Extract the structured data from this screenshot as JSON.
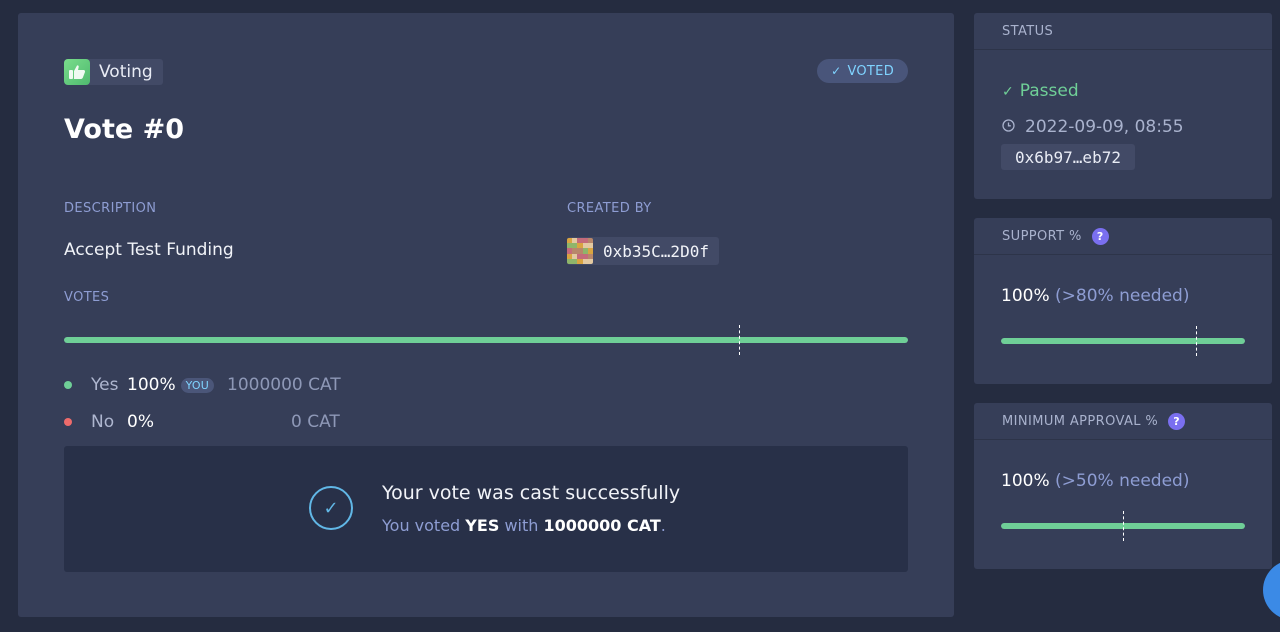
{
  "app": {
    "label": "Voting",
    "voted_badge": "VOTED"
  },
  "vote": {
    "title": "Vote #0",
    "description_label": "DESCRIPTION",
    "description": "Accept Test Funding",
    "created_by_label": "CREATED BY",
    "creator_address": "0xb35C…2D0f",
    "votes_label": "VOTES",
    "yes_fraction": 1.0,
    "threshold_fraction": 0.8,
    "options": [
      {
        "label": "Yes",
        "pct": "100%",
        "you_badge": "YOU",
        "amount": "1000000 CAT",
        "color": "#6fcf97"
      },
      {
        "label": "No",
        "pct": "0%",
        "amount": "0 CAT",
        "color": "#ee6b6b"
      }
    ]
  },
  "success": {
    "title": "Your vote was cast successfully",
    "sub_prefix": "You voted",
    "sub_choice": "YES",
    "sub_with": "with",
    "sub_amount": "1000000 CAT",
    "sub_suffix": "."
  },
  "status": {
    "header": "STATUS",
    "result": "Passed",
    "date": "2022-09-09, 08:55",
    "hash": "0x6b97…eb72"
  },
  "support": {
    "header": "SUPPORT %",
    "value": "100%",
    "needed": "(>80% needed)",
    "fill_fraction": 1.0,
    "threshold_fraction": 0.8
  },
  "min_approval": {
    "header": "MINIMUM APPROVAL %",
    "value": "100%",
    "needed": "(>50% needed)",
    "fill_fraction": 1.0,
    "threshold_fraction": 0.5
  },
  "icons": {
    "app": "thumbs-icon",
    "voted": "check-icon",
    "passed": "check-icon",
    "date": "clock-icon",
    "help": "question-icon",
    "success": "check-circle-icon"
  },
  "colors": {
    "accent_green": "#6fcf97",
    "accent_blue": "#61b7e6",
    "no_red": "#ee6b6b"
  }
}
